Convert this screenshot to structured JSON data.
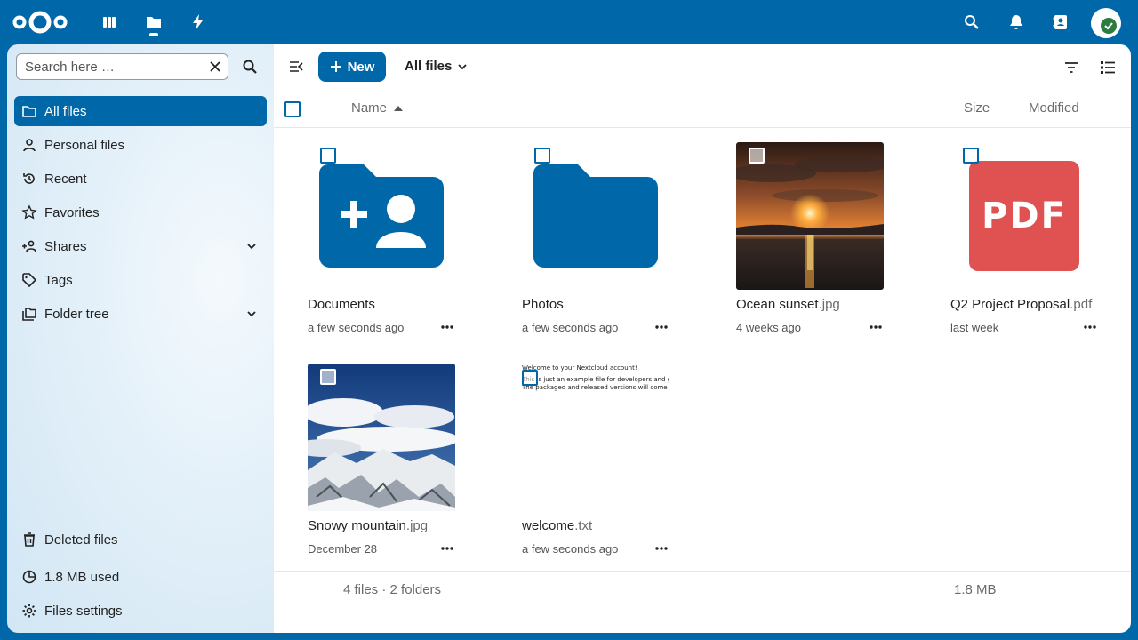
{
  "colors": {
    "primary": "#0067a8",
    "pdf_red": "#e05252",
    "status_green": "#2d7b41"
  },
  "topbar": {
    "apps": [
      "dashboard-icon",
      "files-icon",
      "activity-icon"
    ],
    "actions": [
      "search-icon",
      "bell-icon",
      "contacts-icon"
    ]
  },
  "search": {
    "placeholder": "Search here …"
  },
  "nav": {
    "items": [
      {
        "label": "All files",
        "icon": "folder-icon",
        "active": true
      },
      {
        "label": "Personal files",
        "icon": "user-icon"
      },
      {
        "label": "Recent",
        "icon": "history-icon"
      },
      {
        "label": "Favorites",
        "icon": "star-icon"
      },
      {
        "label": "Shares",
        "icon": "share-icon",
        "expandable": true
      },
      {
        "label": "Tags",
        "icon": "tag-icon"
      },
      {
        "label": "Folder tree",
        "icon": "folder-tree-icon",
        "expandable": true
      }
    ],
    "deleted": "Deleted files",
    "quota": "1.8 MB used",
    "settings": "Files settings"
  },
  "toolbar": {
    "new_label": "New",
    "breadcrumb": "All files"
  },
  "list_header": {
    "name": "Name",
    "size": "Size",
    "modified": "Modified"
  },
  "files": [
    {
      "name": "Documents",
      "ext": "",
      "date": "a few seconds ago",
      "kind": "shared-folder"
    },
    {
      "name": "Photos",
      "ext": "",
      "date": "a few seconds ago",
      "kind": "folder"
    },
    {
      "name": "Ocean sunset",
      "ext": ".jpg",
      "date": "4 weeks ago",
      "kind": "image-sunset"
    },
    {
      "name": "Q2 Project Proposal",
      "ext": ".pdf",
      "date": "last week",
      "kind": "pdf",
      "badge": "PDF"
    },
    {
      "name": "Snowy mountain",
      "ext": ".jpg",
      "date": "December 28",
      "kind": "image-mountain"
    },
    {
      "name": "welcome",
      "ext": ".txt",
      "date": "a few seconds ago",
      "kind": "text",
      "preview": [
        "Welcome to your Nextcloud account!",
        "This is just an example file for developers and git users.",
        "The packaged and released versions will come with"
      ]
    }
  ],
  "footer": {
    "summary": "4 files · 2 folders",
    "size": "1.8 MB"
  }
}
